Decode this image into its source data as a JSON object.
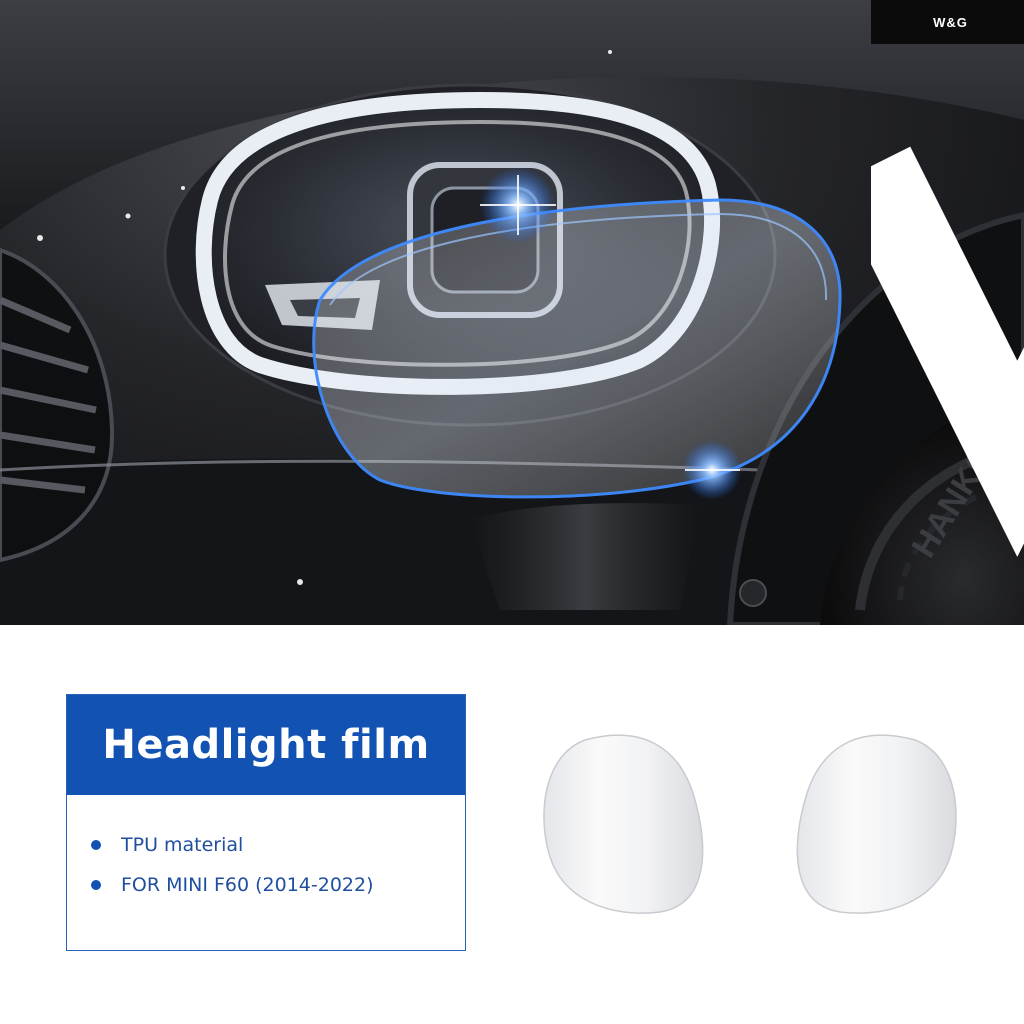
{
  "brand": {
    "name": "W&G"
  },
  "product": {
    "title": "Headlight film",
    "features": [
      "TPU material",
      "FOR MINI F60 (2014-2022)"
    ]
  },
  "tire_text": "HANKOOK",
  "colors": {
    "accent": "#1152b3",
    "badge_bg": "#0b0b0b",
    "film_glow": "#3f8cff"
  },
  "icons": [
    "brand-logo-icon",
    "bullet-dot-icon"
  ]
}
